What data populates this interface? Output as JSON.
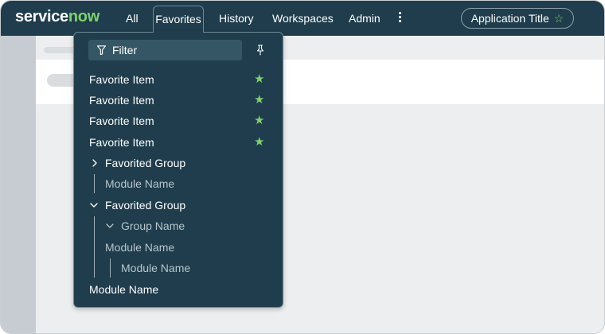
{
  "brand": {
    "logo_main": "service",
    "logo_now": "now"
  },
  "nav": {
    "all": "All",
    "favorites": "Favorites",
    "history": "History",
    "workspaces": "Workspaces",
    "admin": "Admin"
  },
  "app_title": {
    "label": "Application Title",
    "star": "☆"
  },
  "favorites_menu": {
    "filter_placeholder": "Filter",
    "items": [
      {
        "label": "Favorite Item",
        "star": "★"
      },
      {
        "label": "Favorite Item",
        "star": "★"
      },
      {
        "label": "Favorite Item",
        "star": "★"
      },
      {
        "label": "Favorite Item",
        "star": "★"
      }
    ],
    "tree": [
      {
        "label": "Favorited Group",
        "expanded": false
      },
      {
        "label": "Module Name"
      },
      {
        "label": "Favorited Group",
        "expanded": true
      },
      {
        "label": "Group Name",
        "expanded": true
      },
      {
        "label": "Module Name"
      },
      {
        "label": "Module Name"
      },
      {
        "label": "Module Name"
      }
    ]
  },
  "colors": {
    "header_bg": "#1f3d4c",
    "accent_green": "#7fd16b"
  }
}
